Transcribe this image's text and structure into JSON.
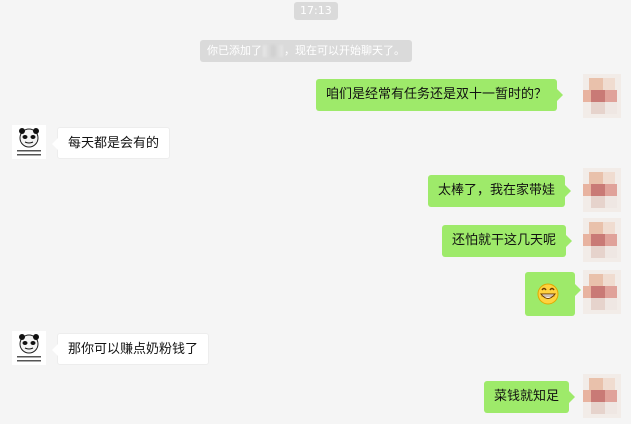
{
  "timestamp": "17:13",
  "system_message": {
    "prefix": "你已添加了",
    "suffix": "，现在可以开始聊天了。"
  },
  "messages": [
    {
      "from": "self",
      "text": "咱们是经常有任务还是双十一暂时的？"
    },
    {
      "from": "contact",
      "text": "每天都是会有的"
    },
    {
      "from": "self",
      "text": "太棒了，我在家带娃"
    },
    {
      "from": "self",
      "text": "还怕就干这几天呢"
    },
    {
      "from": "self",
      "text": "grinning-emoji"
    },
    {
      "from": "contact",
      "text": "那你可以赚点奶粉钱了"
    },
    {
      "from": "self",
      "text": "菜钱就知足"
    }
  ],
  "colors": {
    "background": "#f5f5f5",
    "outgoing_bubble": "#9eea6a",
    "incoming_bubble": "#ffffff",
    "system_pill": "#dadada"
  }
}
